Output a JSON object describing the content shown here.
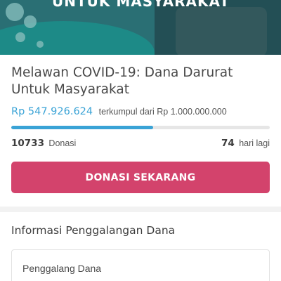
{
  "banner": {
    "headline": "UNTUK MASYARAKAT"
  },
  "campaign": {
    "title": "Melawan COVID-19: Dana Darurat Untuk Masyarakat",
    "collected_amount": "Rp 547.926.624",
    "collected_suffix": "terkumpul dari Rp 1.000.000.000",
    "progress_fraction": 0.548,
    "donations_count": "10733",
    "donations_label": "Donasi",
    "days_left": "74",
    "days_left_label": "hari lagi",
    "donate_button_label": "DONASI SEKARANG"
  },
  "colors": {
    "accent_blue": "#3aa3d6",
    "button_pink": "#d3436c",
    "banner_teal": "#2a6f74"
  },
  "info_section": {
    "title": "Informasi Penggalangan Dana",
    "fundraiser_label": "Penggalang Dana"
  }
}
